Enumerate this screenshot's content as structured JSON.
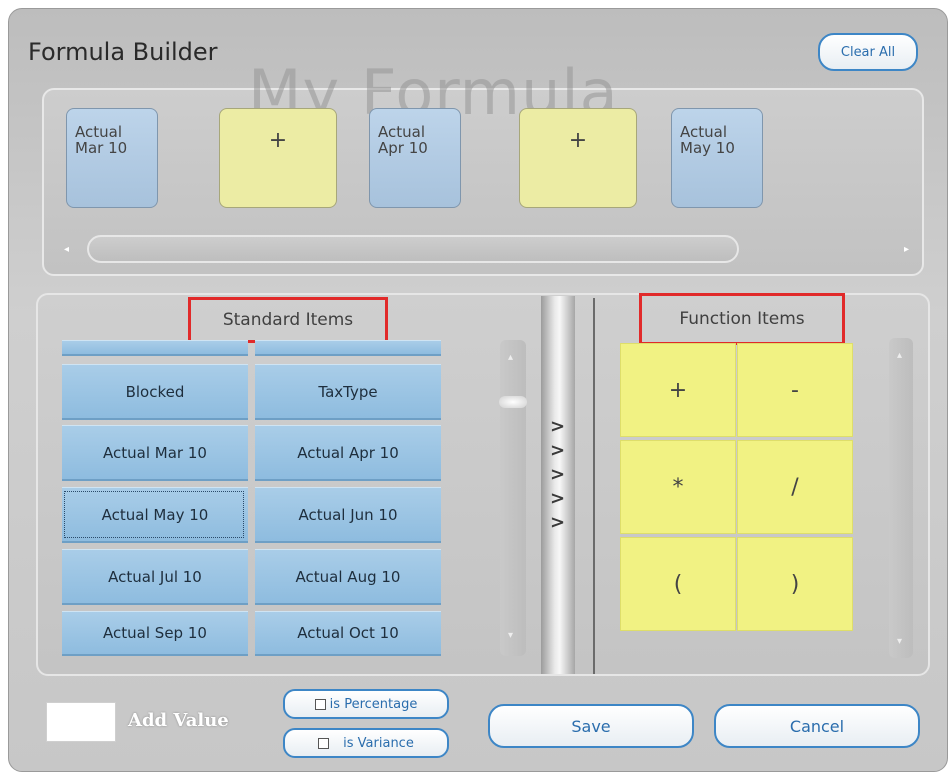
{
  "window": {
    "title": "Formula Builder",
    "clear_all_label": "Clear All"
  },
  "formula": {
    "watermark": "My Formula",
    "tokens": [
      {
        "label": "Actual Mar 10",
        "kind": "item"
      },
      {
        "label": "+",
        "kind": "operator"
      },
      {
        "label": "Actual Apr 10",
        "kind": "item"
      },
      {
        "label": "+",
        "kind": "operator"
      },
      {
        "label": "Actual May 10",
        "kind": "item"
      }
    ]
  },
  "standard_items": {
    "title": "Standard Items",
    "rows": [
      [
        "Blocked",
        "TaxType"
      ],
      [
        "Actual Mar 10",
        "Actual Apr 10"
      ],
      [
        "Actual May 10",
        "Actual Jun 10"
      ],
      [
        "Actual Jul 10",
        "Actual Aug 10"
      ],
      [
        "Actual Sep 10",
        "Actual Oct 10"
      ]
    ],
    "focused_item": "Actual May 10"
  },
  "function_items": {
    "title": "Function Items",
    "rows": [
      [
        "+",
        "-"
      ],
      [
        "*",
        "/"
      ],
      [
        "(",
        ")"
      ]
    ]
  },
  "footer": {
    "add_value_label": "Add Value",
    "value_input": "",
    "is_percentage_label": "is Percentage",
    "is_variance_label": "is Variance",
    "save_label": "Save",
    "cancel_label": "Cancel"
  },
  "colors": {
    "accent": "#3d86c6",
    "standard_cell": "#9fc7e6",
    "function_cell": "#f1f283",
    "highlight_box": "#e12a2a"
  }
}
